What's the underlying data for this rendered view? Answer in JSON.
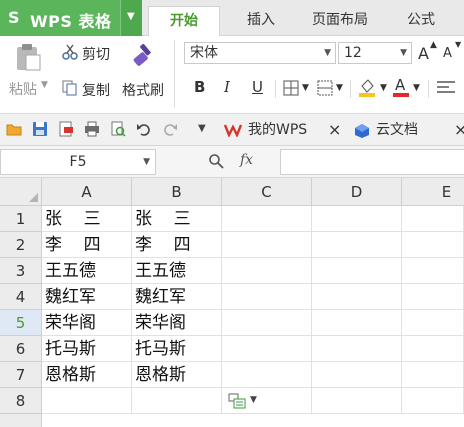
{
  "app": {
    "logo_glyph": "S",
    "title": "WPS 表格",
    "accent_color": "#5bb65b"
  },
  "tabs": [
    {
      "label": "开始",
      "active": true
    },
    {
      "label": "插入",
      "active": false
    },
    {
      "label": "页面布局",
      "active": false
    },
    {
      "label": "公式",
      "active": false
    }
  ],
  "ribbon": {
    "paste_label": "粘贴",
    "cut_label": "剪切",
    "copy_label": "复制",
    "format_painter_label": "格式刷",
    "font_name": "宋体",
    "font_size": "12",
    "bold": "B",
    "italic": "I",
    "underline": "U",
    "grow_font": "A",
    "shrink_font": "A",
    "font_color_glyph": "A"
  },
  "quick_access": {
    "doc_tabs": [
      {
        "label": "我的WPS",
        "icon": "wps-logo-icon",
        "close": "×"
      },
      {
        "label": "云文档",
        "icon": "cloud-docs-icon",
        "close": "×"
      }
    ]
  },
  "formula_bar": {
    "cell_ref": "F5",
    "fx_label": "fx",
    "formula_value": ""
  },
  "sheet": {
    "columns": [
      "A",
      "B",
      "C",
      "D",
      "E"
    ],
    "rows": [
      {
        "n": "1",
        "a": "张    三",
        "b": "张    三"
      },
      {
        "n": "2",
        "a": "李    四",
        "b": "李    四"
      },
      {
        "n": "3",
        "a": "王五德",
        "b": "王五德"
      },
      {
        "n": "4",
        "a": "魏红军",
        "b": "魏红军"
      },
      {
        "n": "5",
        "a": "荣华阁",
        "b": "荣华阁"
      },
      {
        "n": "6",
        "a": "托马斯",
        "b": "托马斯"
      },
      {
        "n": "7",
        "a": "恩格斯",
        "b": "恩格斯"
      },
      {
        "n": "8",
        "a": "",
        "b": ""
      }
    ],
    "selected_row": "5"
  }
}
